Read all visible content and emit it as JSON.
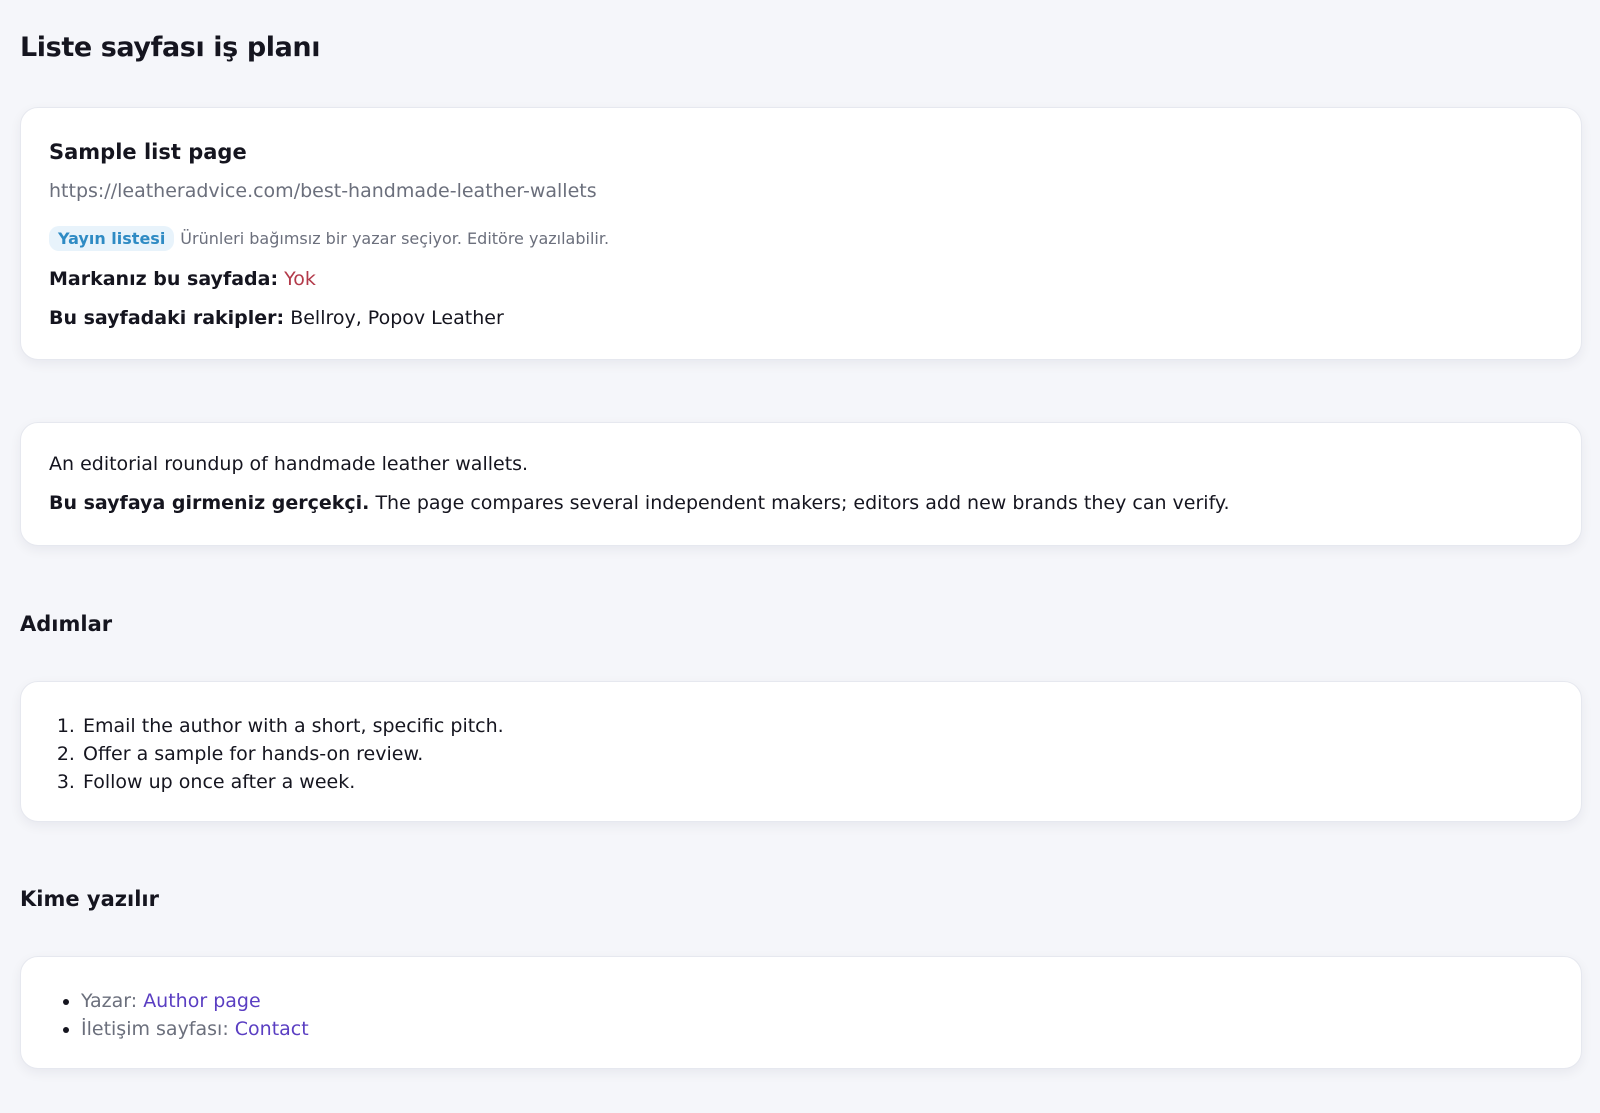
{
  "page": {
    "title": "Liste sayfası iş planı"
  },
  "sample": {
    "title": "Sample list page",
    "url": "https://leatheradvice.com/best-handmade-leather-wallets",
    "tag": "Yayın listesi",
    "tag_note": "Ürünleri bağımsız bir yazar seçiyor. Editöre yazılabilir.",
    "brand_label": "Markanız bu sayfada:",
    "brand_value": "Yok",
    "competitors_label": "Bu sayfadaki rakipler:",
    "competitors_value": "Bellroy, Popov Leather",
    "colors": {
      "tag_bg": "#e8f3fb",
      "tag_text": "#2f8bc4",
      "no_value": "#b33a4a"
    }
  },
  "summary": {
    "text": "An editorial roundup of handmade leather wallets.",
    "verdict_label": "Bu sayfaya girmeniz gerçekçi.",
    "verdict_text": "The page compares several independent makers; editors add new brands they can verify."
  },
  "steps": {
    "heading": "Adımlar",
    "items": [
      "Email the author with a short, specific pitch.",
      "Offer a sample for hands-on review.",
      "Follow up once after a week."
    ]
  },
  "contacts": {
    "heading": "Kime yazılır",
    "items": [
      {
        "label": "Yazar:",
        "link": "Author page"
      },
      {
        "label": "İletişim sayfası:",
        "link": "Contact"
      }
    ],
    "link_color": "#5a3ec2"
  }
}
